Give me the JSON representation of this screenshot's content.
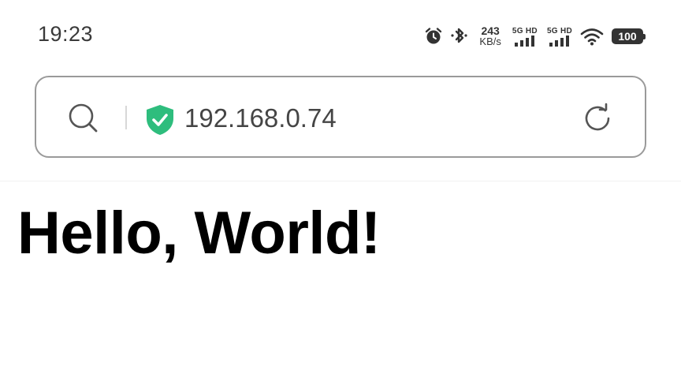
{
  "status_bar": {
    "time": "19:23",
    "net_speed_value": "243",
    "net_speed_unit": "KB/s",
    "sim1_label": "5G HD",
    "sim2_label": "5G HD",
    "battery_level": "100",
    "icons": [
      "alarm-icon",
      "bluetooth-icon",
      "signal-icon",
      "signal-icon",
      "wifi-icon",
      "battery-icon"
    ]
  },
  "address_bar": {
    "url": "192.168.0.74",
    "secure_icon_color": "#2ebd7d",
    "icons": [
      "search-icon",
      "shield-check-icon",
      "reload-icon"
    ]
  },
  "page": {
    "heading": "Hello, World!"
  }
}
